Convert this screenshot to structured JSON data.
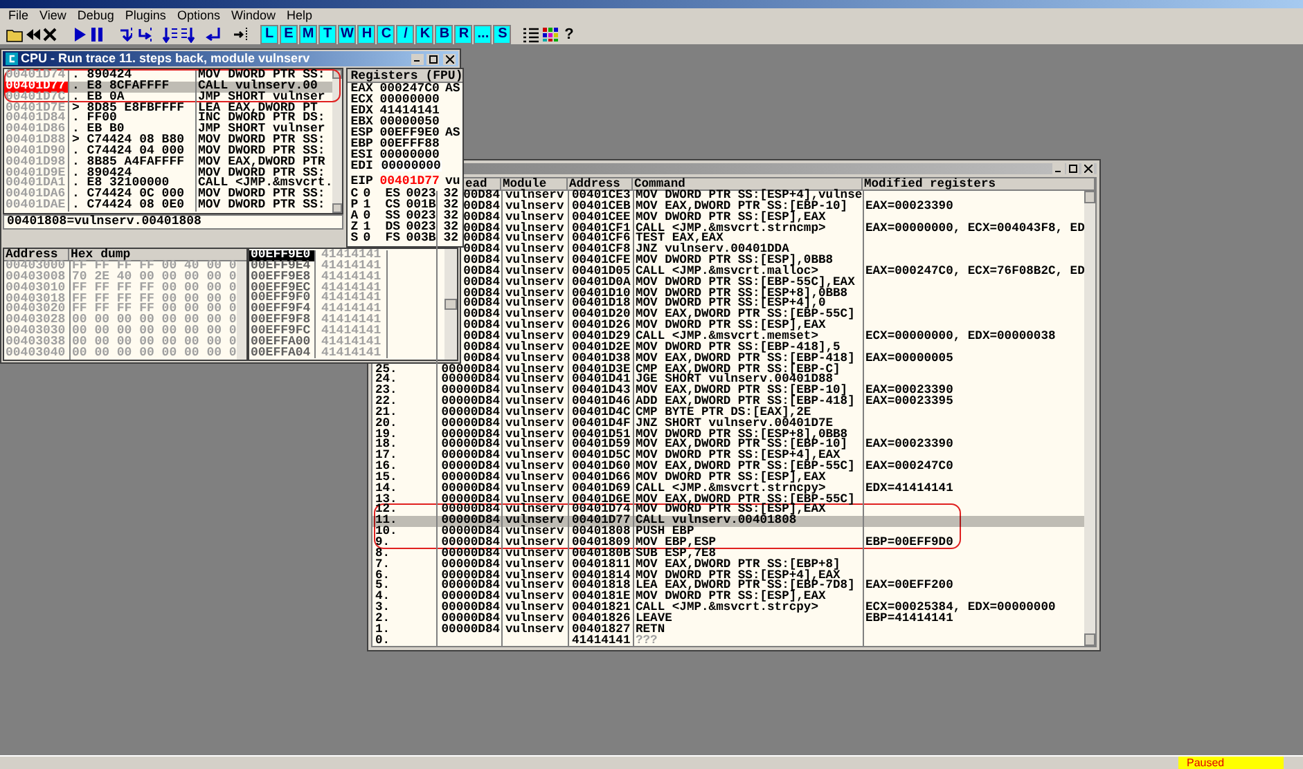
{
  "menu": [
    "File",
    "View",
    "Debug",
    "Plugins",
    "Options",
    "Window",
    "Help"
  ],
  "toolbar_letters": [
    "L",
    "E",
    "M",
    "T",
    "W",
    "H",
    "C",
    "/",
    "K",
    "B",
    "R",
    "...",
    "S"
  ],
  "help_button": "?",
  "cpu_window": {
    "title": "CPU - Run trace 11. steps back, module vulnserv",
    "disassembly": [
      {
        "address": "00401D74",
        "hex": ". 890424",
        "command": "MOV DWORD PTR SS:",
        "selected": false,
        "circled": true
      },
      {
        "address": "00401D77",
        "hex": ". E8 8CFAFFFF",
        "command": "CALL vulnserv.00",
        "selected": true,
        "circled": true
      },
      {
        "address": "00401D7C",
        "hex": ". EB 0A",
        "command": "JMP SHORT vulnser",
        "selected": false,
        "circled": true
      },
      {
        "address": "00401D7E",
        "hex": "> 8D85 E8FBFFFF",
        "command": "LEA EAX,DWORD PT",
        "selected": false,
        "circled": false
      },
      {
        "address": "00401D84",
        "hex": ". FF00",
        "command": "INC DWORD PTR DS:",
        "selected": false,
        "circled": false
      },
      {
        "address": "00401D86",
        "hex": ". EB B0",
        "command": "JMP SHORT vulnser",
        "selected": false,
        "circled": false
      },
      {
        "address": "00401D88",
        "hex": "> C74424 08 B80",
        "command": "MOV DWORD PTR SS:",
        "selected": false,
        "circled": false
      },
      {
        "address": "00401D90",
        "hex": ". C74424 04 000",
        "command": "MOV DWORD PTR SS:",
        "selected": false,
        "circled": false
      },
      {
        "address": "00401D98",
        "hex": ". 8B85 A4FAFFFF",
        "command": "MOV EAX,DWORD PTR",
        "selected": false,
        "circled": false
      },
      {
        "address": "00401D9E",
        "hex": ". 890424",
        "command": "MOV DWORD PTR SS:",
        "selected": false,
        "circled": false
      },
      {
        "address": "00401DA1",
        "hex": ". E8 32100000",
        "command": "CALL <JMP.&msvcrt.",
        "selected": false,
        "circled": false
      },
      {
        "address": "00401DA6",
        "hex": ". C74424 0C 000",
        "command": "MOV DWORD PTR SS:",
        "selected": false,
        "circled": false
      },
      {
        "address": "00401DAE",
        "hex": ". C74424 08 0E0",
        "command": "MOV DWORD PTR SS:",
        "selected": false,
        "circled": false
      }
    ],
    "info_line": "00401808=vulnserv.00401808",
    "registers_header": "Registers (FPU)",
    "registers": [
      {
        "name": "EAX",
        "value": "000247C0",
        "note": "AS",
        "changed": false,
        "selected": false
      },
      {
        "name": "ECX",
        "value": "00000000",
        "changed": false,
        "selected": false
      },
      {
        "name": "EDX",
        "value": "41414141",
        "changed": false,
        "selected": false
      },
      {
        "name": "EBX",
        "value": "00000050",
        "changed": false,
        "selected": false
      },
      {
        "name": "ESP",
        "value": "00EFF9E0",
        "note": "AS",
        "changed": false,
        "selected": false
      },
      {
        "name": "EBP",
        "value": "00EFFF88",
        "changed": false,
        "selected": false
      },
      {
        "name": "ESI",
        "value": "00000000",
        "changed": false,
        "selected": false
      },
      {
        "name": "EDI",
        "value": "00000000",
        "changed": false,
        "selected": true
      }
    ],
    "eip": {
      "name": "EIP",
      "value": "00401D77",
      "note": "vu",
      "changed": true
    },
    "flags": [
      {
        "flag": "C",
        "bit": "0",
        "segment": "ES",
        "selector": "0023",
        "bits": "32"
      },
      {
        "flag": "P",
        "bit": "1",
        "segment": "CS",
        "selector": "001B",
        "bits": "32"
      },
      {
        "flag": "A",
        "bit": "0",
        "segment": "SS",
        "selector": "0023",
        "bits": "32"
      },
      {
        "flag": "Z",
        "bit": "1",
        "segment": "DS",
        "selector": "0023",
        "bits": "32"
      },
      {
        "flag": "S",
        "bit": "0",
        "segment": "FS",
        "selector": "003B",
        "bits": "32"
      }
    ],
    "dump_columns": [
      "Address",
      "Hex dump"
    ],
    "dump": [
      {
        "address": "00403000",
        "hex": "FF FF FF FF 00 40 00 0"
      },
      {
        "address": "00403008",
        "hex": "70 2E 40 00 00 00 00 0"
      },
      {
        "address": "00403010",
        "hex": "FF FF FF FF 00 00 00 0"
      },
      {
        "address": "00403018",
        "hex": "FF FF FF FF 00 00 00 0"
      },
      {
        "address": "00403020",
        "hex": "FF FF FF FF 00 00 00 0"
      },
      {
        "address": "00403028",
        "hex": "00 00 00 00 00 00 00 0"
      },
      {
        "address": "00403030",
        "hex": "00 00 00 00 00 00 00 0"
      },
      {
        "address": "00403038",
        "hex": "00 00 00 00 00 00 00 0"
      },
      {
        "address": "00403040",
        "hex": "00 00 00 00 00 00 00 0"
      }
    ],
    "stack": [
      {
        "address": "00EFF9E0",
        "value": "41414141",
        "selected": true
      },
      {
        "address": "00EFF9E4",
        "value": "41414141",
        "selected": false
      },
      {
        "address": "00EFF9E8",
        "value": "41414141",
        "selected": false
      },
      {
        "address": "00EFF9EC",
        "value": "41414141",
        "selected": false
      },
      {
        "address": "00EFF9F0",
        "value": "41414141",
        "selected": false
      },
      {
        "address": "00EFF9F4",
        "value": "41414141",
        "selected": false
      },
      {
        "address": "00EFF9F8",
        "value": "41414141",
        "selected": false
      },
      {
        "address": "00EFF9FC",
        "value": "41414141",
        "selected": false
      },
      {
        "address": "00EFFA00",
        "value": "41414141",
        "selected": false
      },
      {
        "address": "00EFFA04",
        "value": "41414141",
        "selected": false
      }
    ]
  },
  "trace_window": {
    "columns": [
      "ead",
      "Module",
      "Address",
      "Command",
      "Modified registers"
    ],
    "rows": [
      {
        "thread": "00D84",
        "module": "vulnserv",
        "address": "00401CE3",
        "command": "MOV DWORD PTR SS:[ESP+4],vulnse",
        "selected": false,
        "circled": false,
        "dim": false
      },
      {
        "thread": "00D84",
        "module": "vulnserv",
        "address": "00401CEB",
        "command": "MOV EAX,DWORD PTR SS:[EBP-10]",
        "registers": "EAX=00023390",
        "selected": false,
        "circled": false,
        "dim": false
      },
      {
        "thread": "00D84",
        "module": "vulnserv",
        "address": "00401CEE",
        "command": "MOV DWORD PTR SS:[ESP],EAX",
        "selected": false,
        "circled": false,
        "dim": false
      },
      {
        "thread": "00D84",
        "module": "vulnserv",
        "address": "00401CF1",
        "command": "CALL <JMP.&msvcrt.strncmp>",
        "registers": "EAX=00000000, ECX=004043F8, ED",
        "selected": false,
        "circled": false,
        "dim": false
      },
      {
        "thread": "00D84",
        "module": "vulnserv",
        "address": "00401CF6",
        "command": "TEST EAX,EAX",
        "selected": false,
        "circled": false,
        "dim": false
      },
      {
        "thread": "00D84",
        "module": "vulnserv",
        "address": "00401CF8",
        "command": "JNZ vulnserv.00401DDA",
        "selected": false,
        "circled": false,
        "dim": false
      },
      {
        "thread": "00D84",
        "module": "vulnserv",
        "address": "00401CFE",
        "command": "MOV DWORD PTR SS:[ESP],0BB8",
        "selected": false,
        "circled": false,
        "dim": false
      },
      {
        "thread": "00D84",
        "module": "vulnserv",
        "address": "00401D05",
        "command": "CALL <JMP.&msvcrt.malloc>",
        "registers": "EAX=000247C0, ECX=76F08B2C, ED",
        "selected": false,
        "circled": false,
        "dim": false
      },
      {
        "thread": "00D84",
        "module": "vulnserv",
        "address": "00401D0A",
        "command": "MOV DWORD PTR SS:[EBP-55C],EAX",
        "selected": false,
        "circled": false,
        "dim": false
      },
      {
        "thread": "00D84",
        "module": "vulnserv",
        "address": "00401D10",
        "command": "MOV DWORD PTR SS:[ESP+8],0BB8",
        "selected": false,
        "circled": false,
        "dim": false
      },
      {
        "thread": "00D84",
        "module": "vulnserv",
        "address": "00401D18",
        "command": "MOV DWORD PTR SS:[ESP+4],0",
        "selected": false,
        "circled": false,
        "dim": false
      },
      {
        "thread": "00D84",
        "module": "vulnserv",
        "address": "00401D20",
        "command": "MOV EAX,DWORD PTR SS:[EBP-55C]",
        "selected": false,
        "circled": false,
        "dim": false
      },
      {
        "thread": "00D84",
        "module": "vulnserv",
        "address": "00401D26",
        "command": "MOV DWORD PTR SS:[ESP],EAX",
        "selected": false,
        "circled": false,
        "dim": false
      },
      {
        "thread": "00D84",
        "module": "vulnserv",
        "address": "00401D29",
        "command": "CALL <JMP.&msvcrt.memset>",
        "registers": "ECX=00000000, EDX=00000038",
        "selected": false,
        "circled": false,
        "dim": false
      },
      {
        "thread": "00D84",
        "module": "vulnserv",
        "address": "00401D2E",
        "command": "MOV DWORD PTR SS:[EBP-418],5",
        "selected": false,
        "circled": false,
        "dim": false
      },
      {
        "thread": "00D84",
        "module": "vulnserv",
        "address": "00401D38",
        "command": "MOV EAX,DWORD PTR SS:[EBP-418]",
        "registers": "EAX=00000005",
        "selected": false,
        "circled": false,
        "dim": false
      },
      {
        "index": "25.",
        "thread": "00000D84",
        "module": "vulnserv",
        "address": "00401D3E",
        "command": "CMP EAX,DWORD PTR SS:[EBP-C]",
        "selected": false,
        "circled": false,
        "dim": false
      },
      {
        "index": "24.",
        "thread": "00000D84",
        "module": "vulnserv",
        "address": "00401D41",
        "command": "JGE SHORT vulnserv.00401D88",
        "selected": false,
        "circled": false,
        "dim": false
      },
      {
        "index": "23.",
        "thread": "00000D84",
        "module": "vulnserv",
        "address": "00401D43",
        "command": "MOV EAX,DWORD PTR SS:[EBP-10]",
        "registers": "EAX=00023390",
        "selected": false,
        "circled": false,
        "dim": false
      },
      {
        "index": "22.",
        "thread": "00000D84",
        "module": "vulnserv",
        "address": "00401D46",
        "command": "ADD EAX,DWORD PTR SS:[EBP-418]",
        "registers": "EAX=00023395",
        "selected": false,
        "circled": false,
        "dim": false
      },
      {
        "index": "21.",
        "thread": "00000D84",
        "module": "vulnserv",
        "address": "00401D4C",
        "command": "CMP BYTE PTR DS:[EAX],2E",
        "selected": false,
        "circled": false,
        "dim": false
      },
      {
        "index": "20.",
        "thread": "00000D84",
        "module": "vulnserv",
        "address": "00401D4F",
        "command": "JNZ SHORT vulnserv.00401D7E",
        "selected": false,
        "circled": false,
        "dim": false
      },
      {
        "index": "19.",
        "thread": "00000D84",
        "module": "vulnserv",
        "address": "00401D51",
        "command": "MOV DWORD PTR SS:[ESP+8],0BB8",
        "selected": false,
        "circled": false,
        "dim": false
      },
      {
        "index": "18.",
        "thread": "00000D84",
        "module": "vulnserv",
        "address": "00401D59",
        "command": "MOV EAX,DWORD PTR SS:[EBP-10]",
        "registers": "EAX=00023390",
        "selected": false,
        "circled": false,
        "dim": false
      },
      {
        "index": "17.",
        "thread": "00000D84",
        "module": "vulnserv",
        "address": "00401D5C",
        "command": "MOV DWORD PTR SS:[ESP+4],EAX",
        "selected": false,
        "circled": false,
        "dim": false
      },
      {
        "index": "16.",
        "thread": "00000D84",
        "module": "vulnserv",
        "address": "00401D60",
        "command": "MOV EAX,DWORD PTR SS:[EBP-55C]",
        "registers": "EAX=000247C0",
        "selected": false,
        "circled": false,
        "dim": false
      },
      {
        "index": "15.",
        "thread": "00000D84",
        "module": "vulnserv",
        "address": "00401D66",
        "command": "MOV DWORD PTR SS:[ESP],EAX",
        "selected": false,
        "circled": false,
        "dim": false
      },
      {
        "index": "14.",
        "thread": "00000D84",
        "module": "vulnserv",
        "address": "00401D69",
        "command": "CALL <JMP.&msvcrt.strncpy>",
        "registers": "EDX=41414141",
        "selected": false,
        "circled": false,
        "dim": false
      },
      {
        "index": "13.",
        "thread": "00000D84",
        "module": "vulnserv",
        "address": "00401D6E",
        "command": "MOV EAX,DWORD PTR SS:[EBP-55C]",
        "selected": false,
        "circled": false,
        "dim": false
      },
      {
        "index": "12.",
        "thread": "00000D84",
        "module": "vulnserv",
        "address": "00401D74",
        "command": "MOV DWORD PTR SS:[ESP],EAX",
        "selected": false,
        "circled": true,
        "dim": false
      },
      {
        "index": "11.",
        "thread": "00000D84",
        "module": "vulnserv",
        "address": "00401D77",
        "command": "CALL vulnserv.00401808",
        "selected": true,
        "circled": true,
        "dim": false
      },
      {
        "index": "10.",
        "thread": "00000D84",
        "module": "vulnserv",
        "address": "00401808",
        "command": "PUSH EBP",
        "selected": false,
        "circled": true,
        "dim": false
      },
      {
        "index": "9.",
        "thread": "00000D84",
        "module": "vulnserv",
        "address": "00401809",
        "command": "MOV EBP,ESP",
        "registers": "EBP=00EFF9D0",
        "selected": false,
        "circled": true,
        "dim": false
      },
      {
        "index": "8.",
        "thread": "00000D84",
        "module": "vulnserv",
        "address": "0040180B",
        "command": "SUB ESP,7E8",
        "selected": false,
        "circled": false,
        "dim": false
      },
      {
        "index": "7.",
        "thread": "00000D84",
        "module": "vulnserv",
        "address": "00401811",
        "command": "MOV EAX,DWORD PTR SS:[EBP+8]",
        "selected": false,
        "circled": false,
        "dim": false
      },
      {
        "index": "6.",
        "thread": "00000D84",
        "module": "vulnserv",
        "address": "00401814",
        "command": "MOV DWORD PTR SS:[ESP+4],EAX",
        "selected": false,
        "circled": false,
        "dim": false
      },
      {
        "index": "5.",
        "thread": "00000D84",
        "module": "vulnserv",
        "address": "00401818",
        "command": "LEA EAX,DWORD PTR SS:[EBP-7D8]",
        "registers": "EAX=00EFF200",
        "selected": false,
        "circled": false,
        "dim": false
      },
      {
        "index": "4.",
        "thread": "00000D84",
        "module": "vulnserv",
        "address": "0040181E",
        "command": "MOV DWORD PTR SS:[ESP],EAX",
        "selected": false,
        "circled": false,
        "dim": false
      },
      {
        "index": "3.",
        "thread": "00000D84",
        "module": "vulnserv",
        "address": "00401821",
        "command": "CALL <JMP.&msvcrt.strcpy>",
        "registers": "ECX=00025384, EDX=00000000",
        "selected": false,
        "circled": false,
        "dim": false
      },
      {
        "index": "2.",
        "thread": "00000D84",
        "module": "vulnserv",
        "address": "00401826",
        "command": "LEAVE",
        "registers": "EBP=41414141",
        "selected": false,
        "circled": false,
        "dim": false
      },
      {
        "index": "1.",
        "thread": "00000D84",
        "module": "vulnserv",
        "address": "00401827",
        "command": "RETN",
        "selected": false,
        "circled": false,
        "dim": false
      },
      {
        "index": "0.",
        "address": "41414141",
        "command": "???",
        "selected": false,
        "circled": false,
        "dim": true
      }
    ]
  },
  "status": "Paused"
}
